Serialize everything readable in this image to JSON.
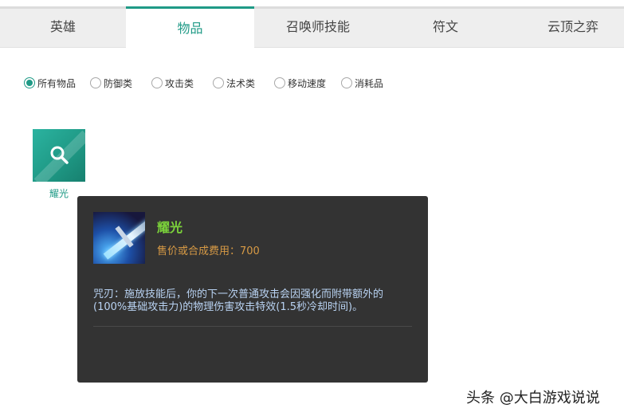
{
  "tabs": [
    {
      "label": "英雄",
      "active": false
    },
    {
      "label": "物品",
      "active": true
    },
    {
      "label": "召唤师技能",
      "active": false
    },
    {
      "label": "符文",
      "active": false
    },
    {
      "label": "云顶之弈",
      "active": false
    }
  ],
  "filters": [
    {
      "label": "所有物品",
      "checked": true
    },
    {
      "label": "防御类",
      "checked": false
    },
    {
      "label": "攻击类",
      "checked": false
    },
    {
      "label": "法术类",
      "checked": false
    },
    {
      "label": "移动速度",
      "checked": false
    },
    {
      "label": "消耗品",
      "checked": false
    }
  ],
  "item": {
    "label": "耀光",
    "icon": "magnifier-icon"
  },
  "tooltip": {
    "title": "耀光",
    "cost": "售价或合成费用：700",
    "description": "咒刃：施放技能后，你的下一次普通攻击会因强化而附带额外的(100%基础攻击力)的物理伤害攻击特效(1.5秒冷却时间)。",
    "icon": "sheen-sword-icon"
  },
  "watermark": "头条 @大白游戏说说",
  "colors": {
    "accent": "#1f9a86",
    "tooltip_bg": "#333333",
    "title": "#7bd23a",
    "cost": "#d79a45",
    "description": "#b9d3f3"
  }
}
